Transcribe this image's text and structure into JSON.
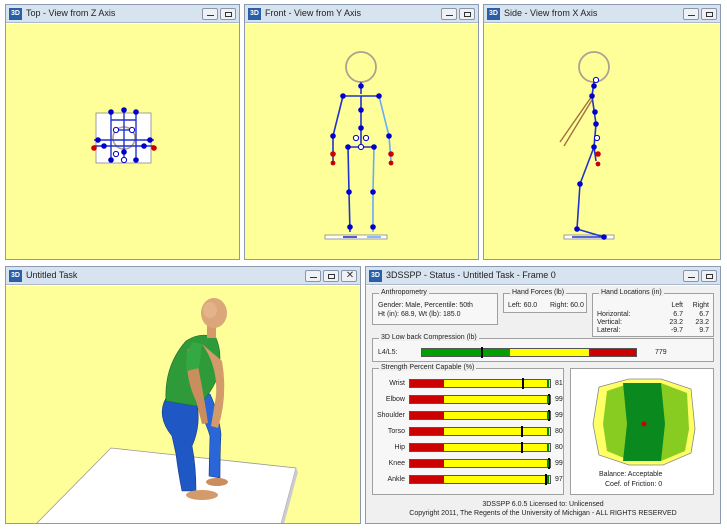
{
  "windows": {
    "top": {
      "title": "Top - View from Z Axis"
    },
    "front": {
      "title": "Front - View from Y Axis"
    },
    "side": {
      "title": "Side - View from X Axis"
    },
    "task": {
      "title": "Untitled Task"
    },
    "status": {
      "title": "3DSSPP - Status - Untitled Task - Frame 0"
    }
  },
  "app_icon": "3D",
  "controls": {
    "minimize_icon": "minimize-icon",
    "restore_icon": "restore-icon",
    "close_glyph": "✕"
  },
  "anthropometry": {
    "label": "Anthropometry",
    "gender_line": "Gender: Male, Percentile: 50th",
    "size_line": "Ht (in): 68.9, Wt (lb): 185.0"
  },
  "hand_forces": {
    "label": "Hand Forces (lb)",
    "left": "Left:  60.0",
    "right": "Right:  60.0"
  },
  "hand_locations": {
    "label": "Hand Locations (in)",
    "col_left": "Left",
    "col_right": "Right",
    "rows": [
      {
        "name": "Horizontal:",
        "left": "6.7",
        "right": "6.7"
      },
      {
        "name": "Vertical:",
        "left": "23.2",
        "right": "23.2"
      },
      {
        "name": "Lateral:",
        "left": "-9.7",
        "right": "9.7"
      }
    ]
  },
  "compression": {
    "label": "3D Low back Compression (lb)",
    "row_label": "L4/L5:",
    "value": "779",
    "fraction": 0.28
  },
  "strength": {
    "label": "Strength Percent Capable (%)",
    "rows": [
      {
        "name": "Wrist",
        "value": "81",
        "pct": 81
      },
      {
        "name": "Elbow",
        "value": "99",
        "pct": 99
      },
      {
        "name": "Shoulder",
        "value": "99",
        "pct": 99
      },
      {
        "name": "Torso",
        "value": "80",
        "pct": 80
      },
      {
        "name": "Hip",
        "value": "80",
        "pct": 80
      },
      {
        "name": "Knee",
        "value": "99",
        "pct": 99
      },
      {
        "name": "Ankle",
        "value": "97",
        "pct": 97
      }
    ]
  },
  "balance": {
    "status": "Balance: Acceptable",
    "friction": "Coef. of Friction:  0"
  },
  "footer": {
    "license": "3DSSPP 6.0.5 Licensed to: Unlicensed",
    "copyright": "Copyright 2011, The Regents of the University of Michigan - ALL RIGHTS RESERVED"
  },
  "colors": {
    "view_bg": "#ffff99",
    "joint": "#0000cc",
    "hand": "#cc0000",
    "bar_red": "#cc0000",
    "bar_yellow": "#ffff00",
    "bar_green": "#00a000"
  }
}
